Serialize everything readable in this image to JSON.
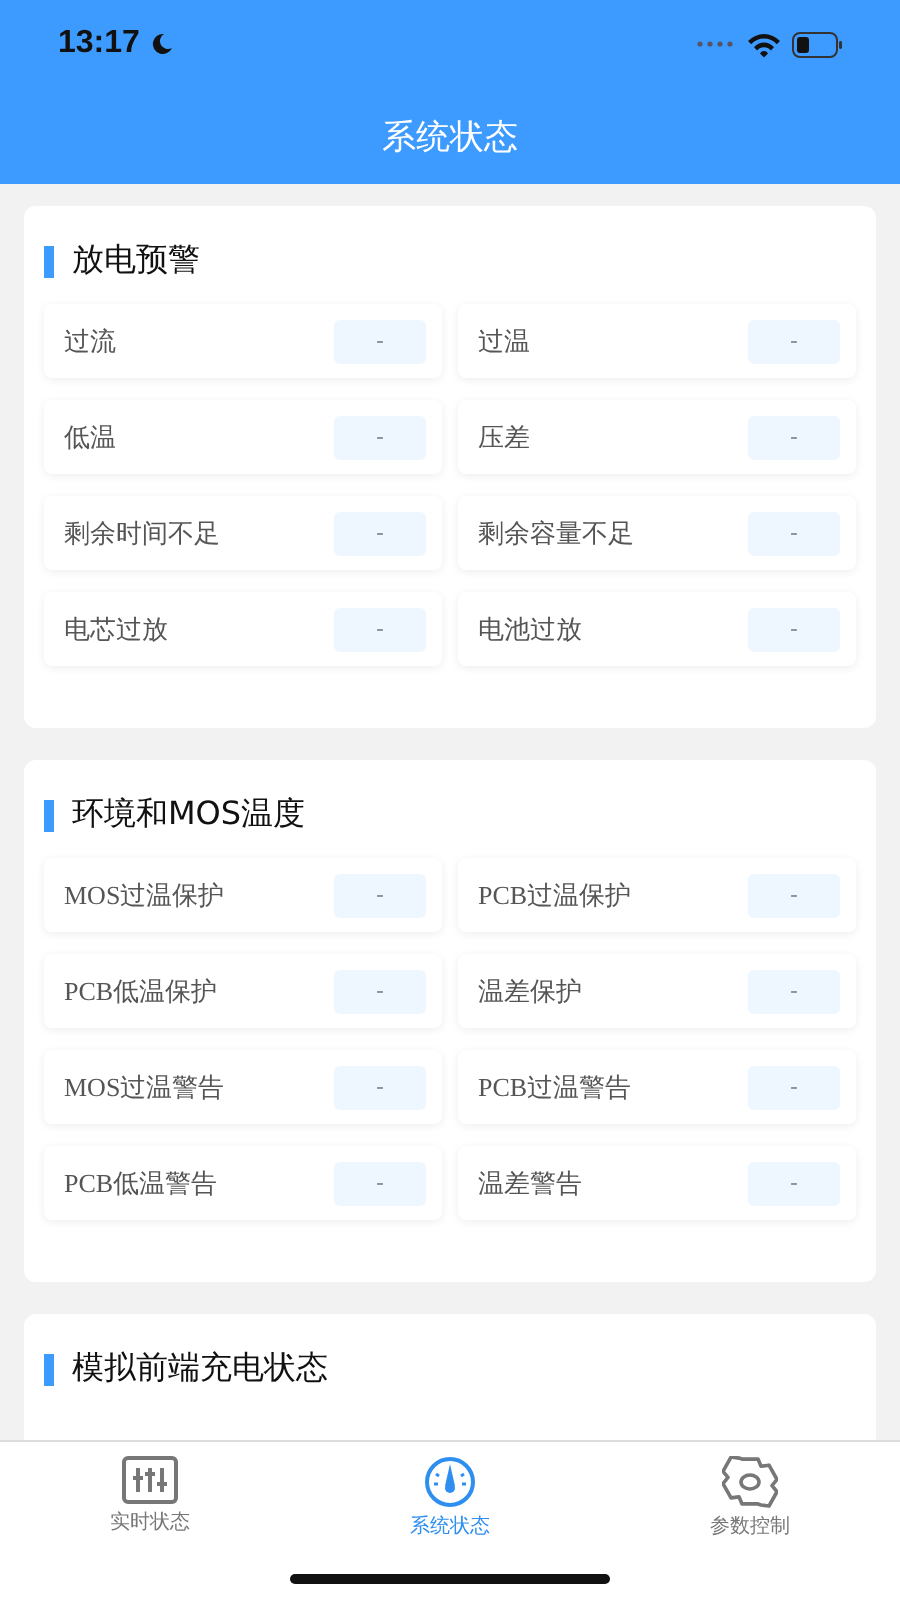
{
  "status_bar": {
    "time": "13:17"
  },
  "header": {
    "title": "系统状态"
  },
  "sections": [
    {
      "title": "放电预警",
      "items": [
        {
          "label": "过流",
          "value": "-"
        },
        {
          "label": "过温",
          "value": "-"
        },
        {
          "label": "低温",
          "value": "-"
        },
        {
          "label": "压差",
          "value": "-"
        },
        {
          "label": "剩余时间不足",
          "value": "-"
        },
        {
          "label": "剩余容量不足",
          "value": "-"
        },
        {
          "label": "电芯过放",
          "value": "-"
        },
        {
          "label": "电池过放",
          "value": "-"
        }
      ]
    },
    {
      "title": "环境和MOS温度",
      "items": [
        {
          "label": "MOS过温保护",
          "value": "-"
        },
        {
          "label": "PCB过温保护",
          "value": "-"
        },
        {
          "label": "PCB低温保护",
          "value": "-"
        },
        {
          "label": "温差保护",
          "value": "-"
        },
        {
          "label": "MOS过温警告",
          "value": "-"
        },
        {
          "label": "PCB过温警告",
          "value": "-"
        },
        {
          "label": "PCB低温警告",
          "value": "-"
        },
        {
          "label": "温差警告",
          "value": "-"
        }
      ]
    },
    {
      "title": "模拟前端充电状态"
    }
  ],
  "tab_bar": [
    {
      "label": "实时状态",
      "kind": "sliders",
      "selected": false
    },
    {
      "label": "系统状态",
      "kind": "gauge",
      "selected": true
    },
    {
      "label": "参数控制",
      "kind": "gear",
      "selected": false
    }
  ]
}
